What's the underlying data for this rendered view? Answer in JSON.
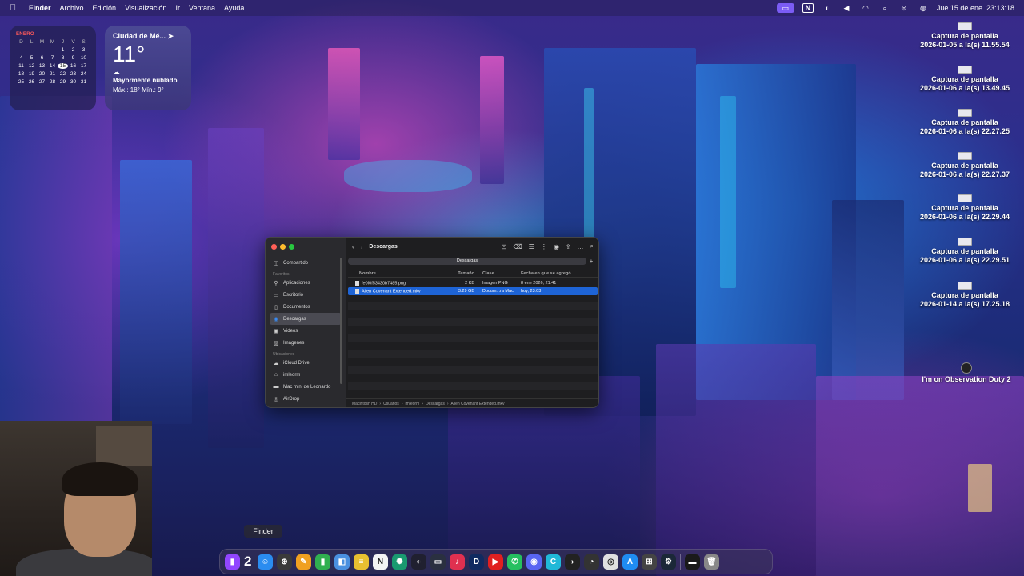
{
  "menubar": {
    "app": "Finder",
    "menus": [
      "Archivo",
      "Edición",
      "Visualización",
      "Ir",
      "Ventana",
      "Ayuda"
    ],
    "datetime": "Jue 15 de ene  23:13:18",
    "status_icons": [
      "screen-mirror-icon",
      "notion-icon",
      "privacy-icon",
      "volume-icon",
      "wifi-icon",
      "search-icon",
      "control-center-icon",
      "siri-icon"
    ]
  },
  "calendar": {
    "month": "ENERO",
    "weekdays": [
      "D",
      "L",
      "M",
      "M",
      "J",
      "V",
      "S"
    ],
    "days": [
      "",
      "",
      "",
      "",
      "1",
      "2",
      "3",
      "4",
      "5",
      "6",
      "7",
      "8",
      "9",
      "10",
      "11",
      "12",
      "13",
      "14",
      "15",
      "16",
      "17",
      "18",
      "19",
      "20",
      "21",
      "22",
      "23",
      "24",
      "25",
      "26",
      "27",
      "28",
      "29",
      "30",
      "31"
    ],
    "today": "15"
  },
  "weather": {
    "city": "Ciudad de Mé...",
    "temp": "11°",
    "desc": "Mayormente nublado",
    "range": "Máx.: 18° Mín.: 9°"
  },
  "desktop_icons": [
    {
      "line1": "Captura de pantalla",
      "line2": "2026-01-05 a la(s) 11.55.54"
    },
    {
      "line1": "Captura de pantalla",
      "line2": "2026-01-06 a la(s) 13.49.45"
    },
    {
      "line1": "Captura de pantalla",
      "line2": "2026-01-06 a la(s) 22.27.25"
    },
    {
      "line1": "Captura de pantalla",
      "line2": "2026-01-06 a la(s) 22.27.37"
    },
    {
      "line1": "Captura de pantalla",
      "line2": "2026-01-06 a la(s) 22.29.44"
    },
    {
      "line1": "Captura de pantalla",
      "line2": "2026-01-06 a la(s) 22.29.51"
    },
    {
      "line1": "Captura de pantalla",
      "line2": "2026-01-14 a la(s) 17.25.18"
    },
    {
      "line1": "I'm on Observation Duty 2",
      "line2": ""
    }
  ],
  "finder": {
    "title": "Descargas",
    "tab": "Descargas",
    "sidebar": {
      "top": [
        {
          "label": "Compartido",
          "icon": "shared-icon"
        }
      ],
      "favorites_header": "Favoritos",
      "favorites": [
        {
          "label": "Aplicaciones",
          "icon": "applications-icon"
        },
        {
          "label": "Escritorio",
          "icon": "desktop-icon"
        },
        {
          "label": "Documentos",
          "icon": "documents-icon"
        },
        {
          "label": "Descargas",
          "icon": "downloads-icon",
          "selected": true
        },
        {
          "label": "Videos",
          "icon": "videos-icon"
        },
        {
          "label": "Imágenes",
          "icon": "images-icon"
        }
      ],
      "locations_header": "Ubicaciones",
      "locations": [
        {
          "label": "iCloud Drive",
          "icon": "icloud-icon"
        },
        {
          "label": "imleorm",
          "icon": "home-icon"
        },
        {
          "label": "Mac mini de Leonardo",
          "icon": "computer-icon"
        },
        {
          "label": "AirDrop",
          "icon": "airdrop-icon"
        }
      ]
    },
    "columns": [
      "Nombre",
      "Tamaño",
      "Clase",
      "Fecha en que se agregó"
    ],
    "rows": [
      {
        "name": "fe0f0f53430b7485.png",
        "size": "2 KB",
        "kind": "Imagen PNG",
        "date": "8 ene 2026, 21:41",
        "selected": false
      },
      {
        "name": "Alien Covenant Extended.mkv",
        "size": "3.29 GB",
        "kind": "Docum...ra Mac",
        "date": "hoy, 23:03",
        "selected": true
      }
    ],
    "path": [
      "Macintosh HD",
      "Usuarios",
      "imleorm",
      "Descargas",
      "Alien Covenant Extended.mkv"
    ]
  },
  "tooltip": "Finder",
  "dock": {
    "badge_number": "2",
    "apps": [
      {
        "name": "finder-icon",
        "color": "#2a8cf0",
        "glyph": "☺"
      },
      {
        "name": "safari-icon",
        "color": "#3a3a3a",
        "glyph": "⊛"
      },
      {
        "name": "pages-icon",
        "color": "#f0a020",
        "glyph": "✎"
      },
      {
        "name": "numbers-icon",
        "color": "#30b050",
        "glyph": "▮"
      },
      {
        "name": "preview-icon",
        "color": "#4a90e0",
        "glyph": "◧"
      },
      {
        "name": "notes-icon",
        "color": "#e8c030",
        "glyph": "≡"
      },
      {
        "name": "notion-icon",
        "color": "#f4f4f4",
        "glyph": "N"
      },
      {
        "name": "chatgpt-icon",
        "color": "#1a9a70",
        "glyph": "✺"
      },
      {
        "name": "steam-deck-icon",
        "color": "#202030",
        "glyph": "◐"
      },
      {
        "name": "media-icon",
        "color": "#2a3040",
        "glyph": "▭"
      },
      {
        "name": "music-icon",
        "color": "#e03050",
        "glyph": "♪"
      },
      {
        "name": "disney-plus-icon",
        "color": "#102a60",
        "glyph": "D"
      },
      {
        "name": "youtube-icon",
        "color": "#e02020",
        "glyph": "▶"
      },
      {
        "name": "whatsapp-icon",
        "color": "#25c060",
        "glyph": "✆"
      },
      {
        "name": "discord-icon",
        "color": "#5865f2",
        "glyph": "◉"
      },
      {
        "name": "canva-icon",
        "color": "#20b8d8",
        "glyph": "C"
      },
      {
        "name": "terminal-icon",
        "color": "#222",
        "glyph": "›"
      },
      {
        "name": "activity-icon",
        "color": "#333",
        "glyph": "◔"
      },
      {
        "name": "chrome-icon",
        "color": "#e0e0e0",
        "glyph": "◎"
      },
      {
        "name": "app-store-icon",
        "color": "#1f8cf2",
        "glyph": "A"
      },
      {
        "name": "launchpad-icon",
        "color": "#444",
        "glyph": "⊞"
      },
      {
        "name": "steam-icon",
        "color": "#1b2838",
        "glyph": "⚙"
      },
      {
        "name": "recent-window-icon",
        "color": "#1a1a1a",
        "glyph": "▬"
      },
      {
        "name": "trash-icon",
        "color": "#888",
        "glyph": "🗑"
      }
    ]
  }
}
